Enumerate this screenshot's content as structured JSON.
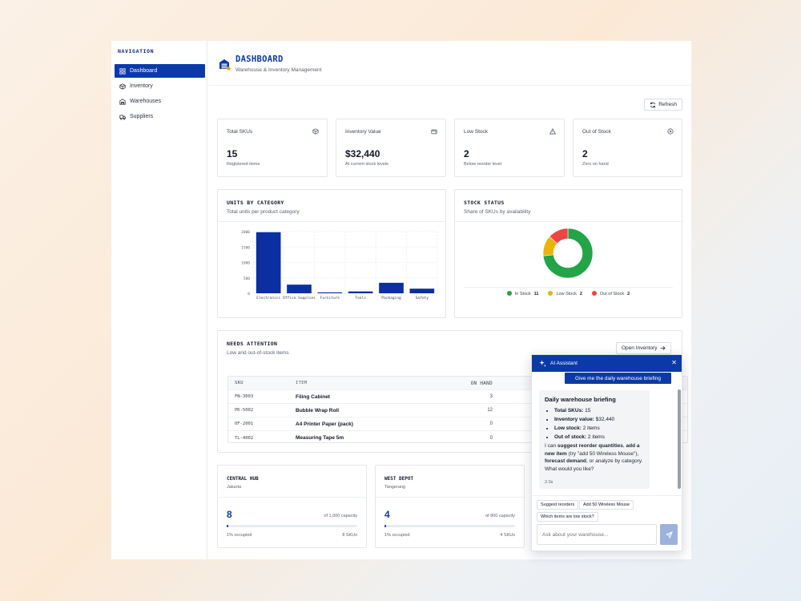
{
  "nav": {
    "title": "NAVIGATION",
    "items": [
      {
        "label": "Dashboard",
        "icon": "grid-icon",
        "active": true
      },
      {
        "label": "Inventory",
        "icon": "box-icon"
      },
      {
        "label": "Warehouses",
        "icon": "warehouse-icon"
      },
      {
        "label": "Suppliers",
        "icon": "truck-icon"
      }
    ]
  },
  "header": {
    "title": "DASHBOARD",
    "subtitle": "Warehouse & Inventory Management",
    "refresh_label": "Refresh"
  },
  "stats": [
    {
      "label": "Total SKUs",
      "value": "15",
      "sub": "Registered items",
      "icon": "package-icon"
    },
    {
      "label": "Inventory Value",
      "value": "$32,440",
      "sub": "At current stock levels",
      "icon": "wallet-icon"
    },
    {
      "label": "Low Stock",
      "value": "2",
      "sub": "Below reorder level",
      "icon": "warning-icon"
    },
    {
      "label": "Out of Stock",
      "value": "2",
      "sub": "Zero on hand",
      "icon": "x-circle-icon"
    }
  ],
  "units_chart": {
    "title": "UNITS BY CATEGORY",
    "subtitle": "Total units per product category"
  },
  "stock_chart": {
    "title": "STOCK STATUS",
    "subtitle": "Share of SKUs by availability"
  },
  "chart_data": [
    {
      "type": "bar",
      "categories": [
        "Electronics",
        "Office Supplies",
        "Furniture",
        "Tools",
        "Packaging",
        "Safety"
      ],
      "values": [
        1980,
        280,
        30,
        60,
        340,
        150
      ],
      "ylim": [
        0,
        2000
      ],
      "yticks": [
        "2000",
        "1500",
        "1000",
        "500",
        "0"
      ],
      "color": "#0b2fa0",
      "grid": true
    },
    {
      "type": "pie",
      "donut": true,
      "series": [
        {
          "name": "In Stock",
          "value": 11,
          "color": "#22a447"
        },
        {
          "name": "Low Stock",
          "value": 2,
          "color": "#eab308"
        },
        {
          "name": "Out of Stock",
          "value": 2,
          "color": "#ef4444"
        }
      ],
      "legend": "bottom"
    }
  ],
  "attention": {
    "title": "NEEDS ATTENTION",
    "subtitle": "Low and out-of-stock items",
    "open_label": "Open Inventory",
    "columns": {
      "sku": "SKU",
      "item": "ITEM",
      "on_hand": "ON HAND"
    },
    "rows": [
      {
        "sku": "FN-3003",
        "item": "Filing Cabinet",
        "on_hand": "3"
      },
      {
        "sku": "PK-5002",
        "item": "Bubble Wrap Roll",
        "on_hand": "12"
      },
      {
        "sku": "OF-2001",
        "item": "A4 Printer Paper (pack)",
        "on_hand": "0"
      },
      {
        "sku": "TL-4002",
        "item": "Measuring Tape 5m",
        "on_hand": "0"
      }
    ]
  },
  "warehouses": [
    {
      "name": "CENTRAL HUB",
      "city": "Jakarta",
      "units": "8",
      "capacity": "of 1,000 capacity",
      "occupied": "1% occupied",
      "skus": "8 SKUs",
      "fill": 0.01
    },
    {
      "name": "WEST DEPOT",
      "city": "Tangerang",
      "units": "4",
      "capacity": "of 800 capacity",
      "occupied": "1% occupied",
      "skus": "4 SKUs",
      "fill": 0.01
    }
  ],
  "ai": {
    "title": "AI Assistant",
    "user_message": "Give me the daily warehouse briefing",
    "briefing_title": "Daily warehouse briefing",
    "bullets": [
      {
        "key": "Total SKUs:",
        "val": " 15"
      },
      {
        "key": "Inventory value:",
        "val": " $32,440"
      },
      {
        "key": "Low stock:",
        "val": " 2 items"
      },
      {
        "key": "Out of stock:",
        "val": " 2 items"
      }
    ],
    "para": {
      "p1": "I can ",
      "b1": "suggest reorder quantities",
      "p2": ", ",
      "b2": "add a new item",
      "p3": " (try \"add 50 Wireless Mouse\"), ",
      "b3": "forecast demand",
      "p4": ", or analyze by category. What would you like?"
    },
    "time": "2.0s",
    "chips": [
      "Suggest reorders",
      "Add 50 Wireless Mouse",
      "Which items are low stock?"
    ],
    "input_placeholder": "Ask about your warehouse..."
  }
}
